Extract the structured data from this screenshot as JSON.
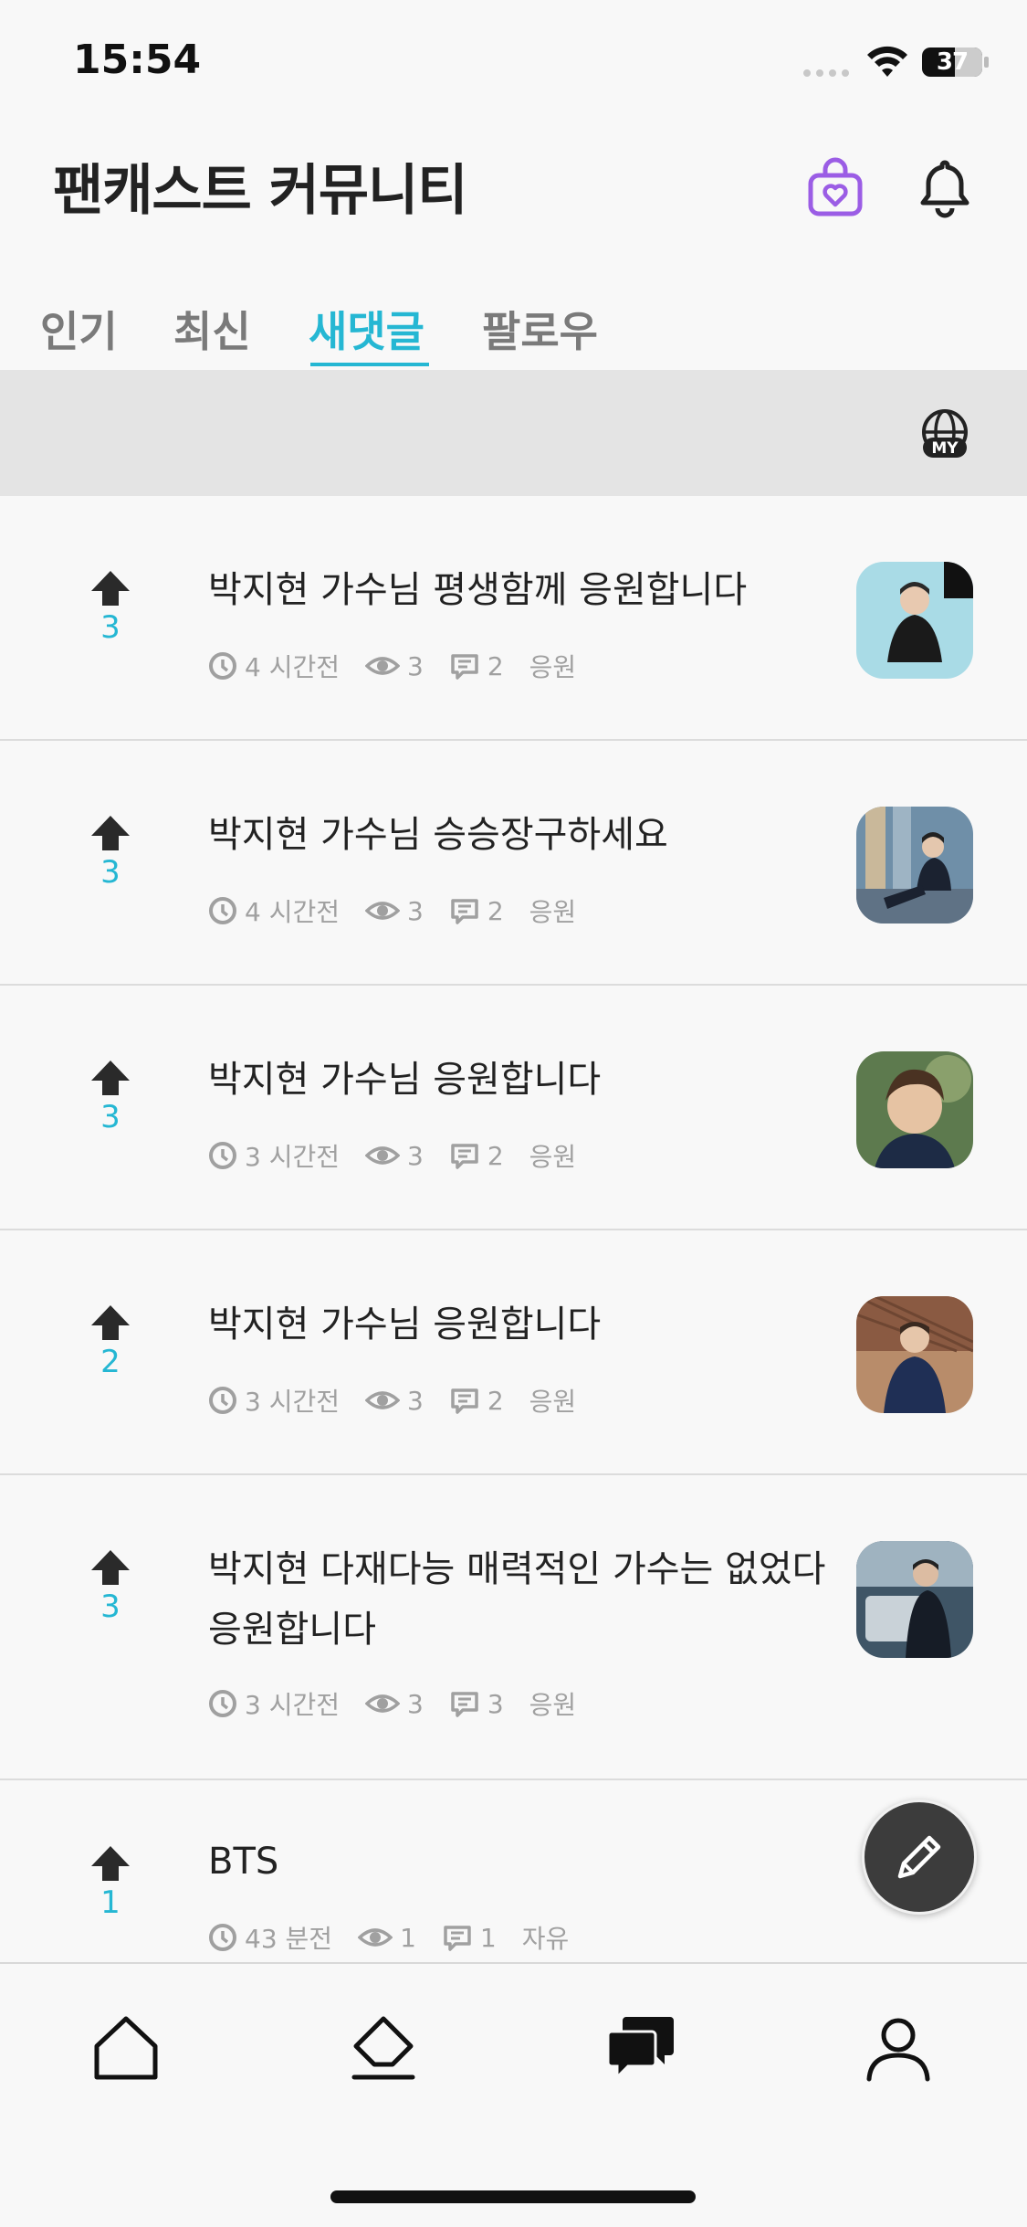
{
  "status": {
    "time": "15:54",
    "battery": "37"
  },
  "header": {
    "title": "팬캐스트 커뮤니티",
    "icons": [
      "shop-bag-heart-icon",
      "bell-icon"
    ]
  },
  "tabs": [
    {
      "label": "인기",
      "active": false
    },
    {
      "label": "최신",
      "active": false
    },
    {
      "label": "새댓글",
      "active": true
    },
    {
      "label": "팔로우",
      "active": false
    }
  ],
  "filter": {
    "my_label": "MY"
  },
  "posts": [
    {
      "votes": "3",
      "title": "박지현 가수님 평생함께 응원합니다",
      "time": "4 시간전",
      "views": "3",
      "comments": "2",
      "category": "응원"
    },
    {
      "votes": "3",
      "title": "박지현 가수님 승승장구하세요",
      "time": "4 시간전",
      "views": "3",
      "comments": "2",
      "category": "응원"
    },
    {
      "votes": "3",
      "title": "박지현 가수님 응원합니다",
      "time": "3 시간전",
      "views": "3",
      "comments": "2",
      "category": "응원"
    },
    {
      "votes": "2",
      "title": "박지현 가수님 응원합니다",
      "time": "3 시간전",
      "views": "3",
      "comments": "2",
      "category": "응원"
    },
    {
      "votes": "3",
      "title": "박지현 다재다능 매력적인 가수는 없었다 응원합니다",
      "time": "3 시간전",
      "views": "3",
      "comments": "3",
      "category": "응원"
    },
    {
      "votes": "1",
      "title": "BTS",
      "time": "43 분전",
      "views": "1",
      "comments": "1",
      "category": "자유"
    }
  ],
  "colors": {
    "accent": "#25b7d3",
    "shop": "#9b5de5",
    "text": "#222222",
    "muted": "#a0a0a0"
  },
  "bottom_nav": [
    "home-icon",
    "eraser-icon",
    "chat-bubbles-icon",
    "profile-icon"
  ]
}
